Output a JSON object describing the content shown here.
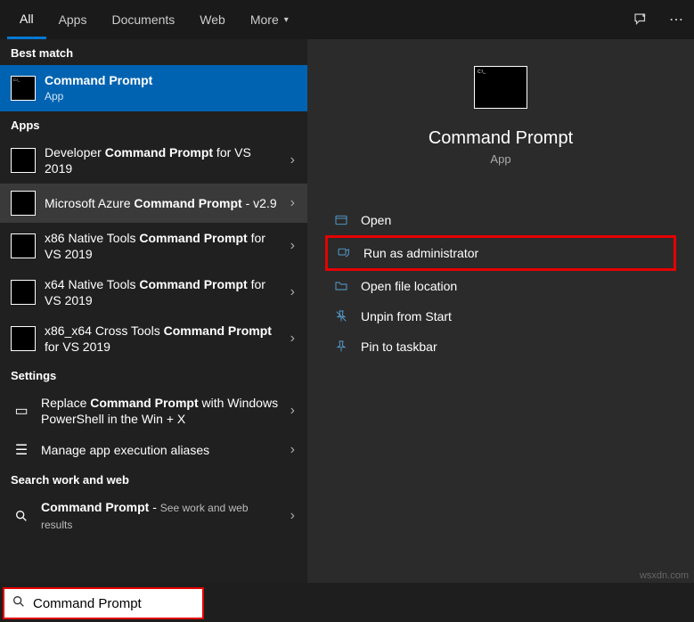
{
  "topbar": {
    "tabs": [
      "All",
      "Apps",
      "Documents",
      "Web",
      "More"
    ],
    "active": 0
  },
  "sections": {
    "best_match": "Best match",
    "apps": "Apps",
    "settings": "Settings",
    "search_web": "Search work and web"
  },
  "best_match": {
    "title": "Command Prompt",
    "sub": "App"
  },
  "apps": [
    {
      "pre": "Developer ",
      "bold": "Command Prompt",
      "post": " for VS 2019"
    },
    {
      "pre": "Microsoft Azure ",
      "bold": "Command Prompt",
      "post": " - v2.9",
      "hover": true
    },
    {
      "pre": "x86 Native Tools ",
      "bold": "Command Prompt",
      "post": " for VS 2019"
    },
    {
      "pre": "x64 Native Tools ",
      "bold": "Command Prompt",
      "post": " for VS 2019"
    },
    {
      "pre": "x86_x64 Cross Tools ",
      "bold": "Command Prompt",
      "post": " for VS 2019"
    }
  ],
  "settings_items": [
    {
      "pre": "Replace ",
      "bold": "Command Prompt",
      "post": " with Windows PowerShell in the Win + X"
    },
    {
      "pre": "Manage app execution aliases",
      "bold": "",
      "post": ""
    }
  ],
  "web_item": {
    "bold": "Command Prompt",
    "post": " - ",
    "hint": "See work and web results"
  },
  "preview": {
    "title": "Command Prompt",
    "sub": "App"
  },
  "actions": [
    {
      "id": "open",
      "label": "Open"
    },
    {
      "id": "run-admin",
      "label": "Run as administrator",
      "highlight": true
    },
    {
      "id": "open-loc",
      "label": "Open file location"
    },
    {
      "id": "unpin-start",
      "label": "Unpin from Start"
    },
    {
      "id": "pin-taskbar",
      "label": "Pin to taskbar"
    }
  ],
  "search": {
    "value": "Command Prompt"
  },
  "watermark": "wsxdn.com"
}
